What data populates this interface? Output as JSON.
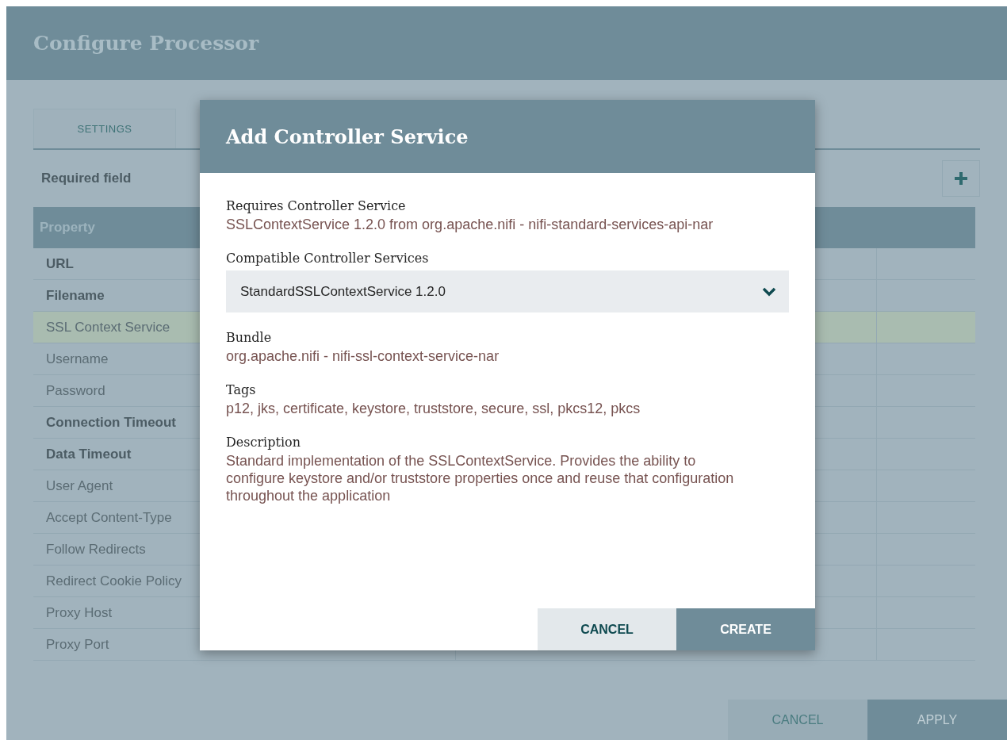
{
  "window": {
    "title": "Configure Processor"
  },
  "tabs": [
    {
      "label": "SETTINGS",
      "selected": false
    }
  ],
  "required_note": "Required field",
  "table": {
    "columns": [
      "Property"
    ],
    "rows": [
      {
        "name": "URL",
        "required": true,
        "selected": false
      },
      {
        "name": "Filename",
        "required": true,
        "selected": false
      },
      {
        "name": "SSL Context Service",
        "required": false,
        "selected": true
      },
      {
        "name": "Username",
        "required": false,
        "selected": false
      },
      {
        "name": "Password",
        "required": false,
        "selected": false
      },
      {
        "name": "Connection Timeout",
        "required": true,
        "selected": false
      },
      {
        "name": "Data Timeout",
        "required": true,
        "selected": false
      },
      {
        "name": "User Agent",
        "required": false,
        "selected": false
      },
      {
        "name": "Accept Content-Type",
        "required": false,
        "selected": false
      },
      {
        "name": "Follow Redirects",
        "required": false,
        "selected": false
      },
      {
        "name": "Redirect Cookie Policy",
        "required": false,
        "selected": false
      },
      {
        "name": "Proxy Host",
        "required": false,
        "selected": false
      },
      {
        "name": "Proxy Port",
        "required": false,
        "selected": false
      }
    ]
  },
  "footer_buttons": [
    {
      "label": "CANCEL",
      "kind": "secondary"
    },
    {
      "label": "APPLY",
      "kind": "primary"
    }
  ],
  "dialog": {
    "title": "Add Controller Service",
    "fields": [
      {
        "label": "Requires Controller Service",
        "kind": "text",
        "value": "SSLContextService 1.2.0 from org.apache.nifi - nifi-standard-services-api-nar"
      },
      {
        "label": "Compatible Controller Services",
        "kind": "select",
        "value": "StandardSSLContextService 1.2.0"
      },
      {
        "label": "Bundle",
        "kind": "text",
        "value": "org.apache.nifi - nifi-ssl-context-service-nar"
      },
      {
        "label": "Tags",
        "kind": "text",
        "value": "p12, jks, certificate, keystore, truststore, secure, ssl, pkcs12, pkcs"
      },
      {
        "label": "Description",
        "kind": "text",
        "value": "Standard implementation of the SSLContextService. Provides the ability to configure keystore and/or truststore properties once and reuse that configuration throughout the application"
      }
    ],
    "buttons": [
      {
        "label": "CANCEL",
        "kind": "secondary"
      },
      {
        "label": "CREATE",
        "kind": "primary"
      }
    ]
  }
}
